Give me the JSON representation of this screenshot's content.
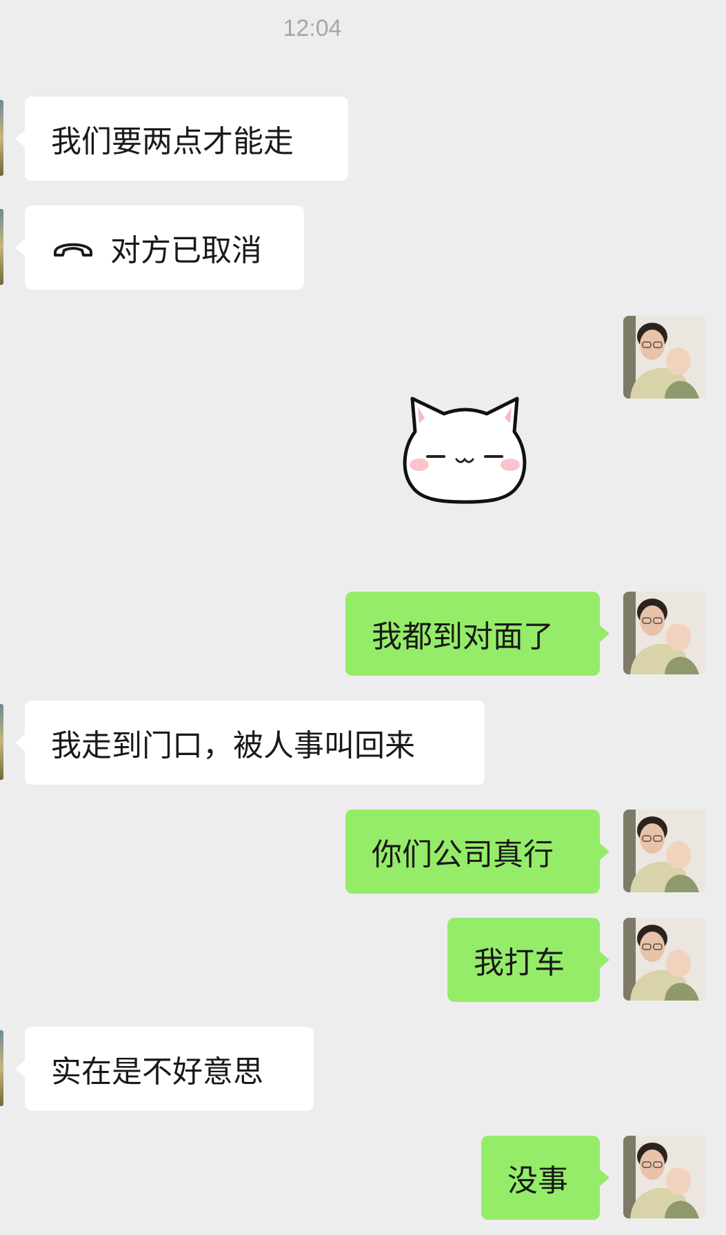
{
  "timestamp": "12:04",
  "messages": [
    {
      "side": "received",
      "text": "我们要两点才能走"
    },
    {
      "side": "received",
      "type": "call",
      "icon": "phone-hangup-icon",
      "text": "对方已取消"
    },
    {
      "side": "sent",
      "type": "sticker",
      "sticker": "white-cat-sticker"
    },
    {
      "side": "sent",
      "text": "我都到对面了"
    },
    {
      "side": "received",
      "text": "我走到门口，被人事叫回来"
    },
    {
      "side": "sent",
      "text": "你们公司真行"
    },
    {
      "side": "sent",
      "text": "我打车"
    },
    {
      "side": "received",
      "text": "实在是不好意思"
    },
    {
      "side": "sent",
      "text": "没事"
    }
  ],
  "colors": {
    "background": "#ededed",
    "sent_bubble": "#95ec69",
    "received_bubble": "#ffffff",
    "timestamp_text": "#a6a6a6"
  }
}
